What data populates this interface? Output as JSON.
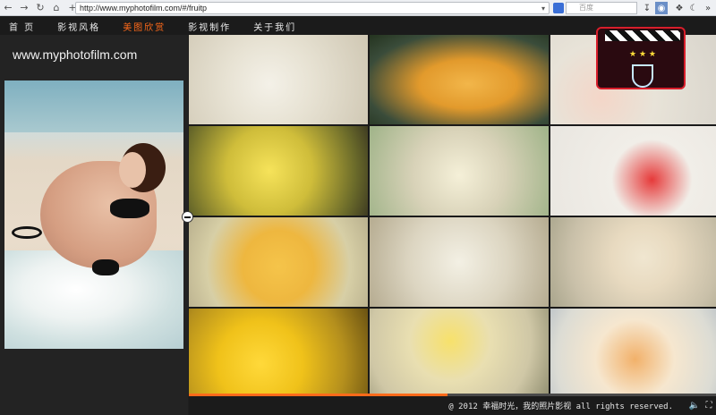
{
  "browser": {
    "url": "http://www.myphotofilm.com/#/fruitp",
    "search_placeholder": "百度",
    "icons": [
      "back-icon",
      "forward-icon",
      "reload-icon",
      "home-icon",
      "new-tab-icon"
    ]
  },
  "nav": {
    "items": [
      {
        "label": "首 页",
        "active": false
      },
      {
        "label": "影视风格",
        "active": false
      },
      {
        "label": "美图欣赏",
        "active": true
      },
      {
        "label": "影视制作",
        "active": false
      },
      {
        "label": "关于我们",
        "active": false
      }
    ],
    "active_color": "#ff6a1a"
  },
  "left": {
    "site_url": "www.myphotofilm.com"
  },
  "gallery": {
    "tiles": [
      "food-photo",
      "food-photo",
      "food-photo",
      "food-photo",
      "food-photo",
      "food-photo",
      "food-photo",
      "food-photo",
      "food-photo",
      "food-photo",
      "food-photo",
      "food-photo"
    ]
  },
  "progress": {
    "fraction": 0.49
  },
  "footer": {
    "copyright": "@ 2012  幸福时光，我的照片影视  all rights reserved."
  }
}
